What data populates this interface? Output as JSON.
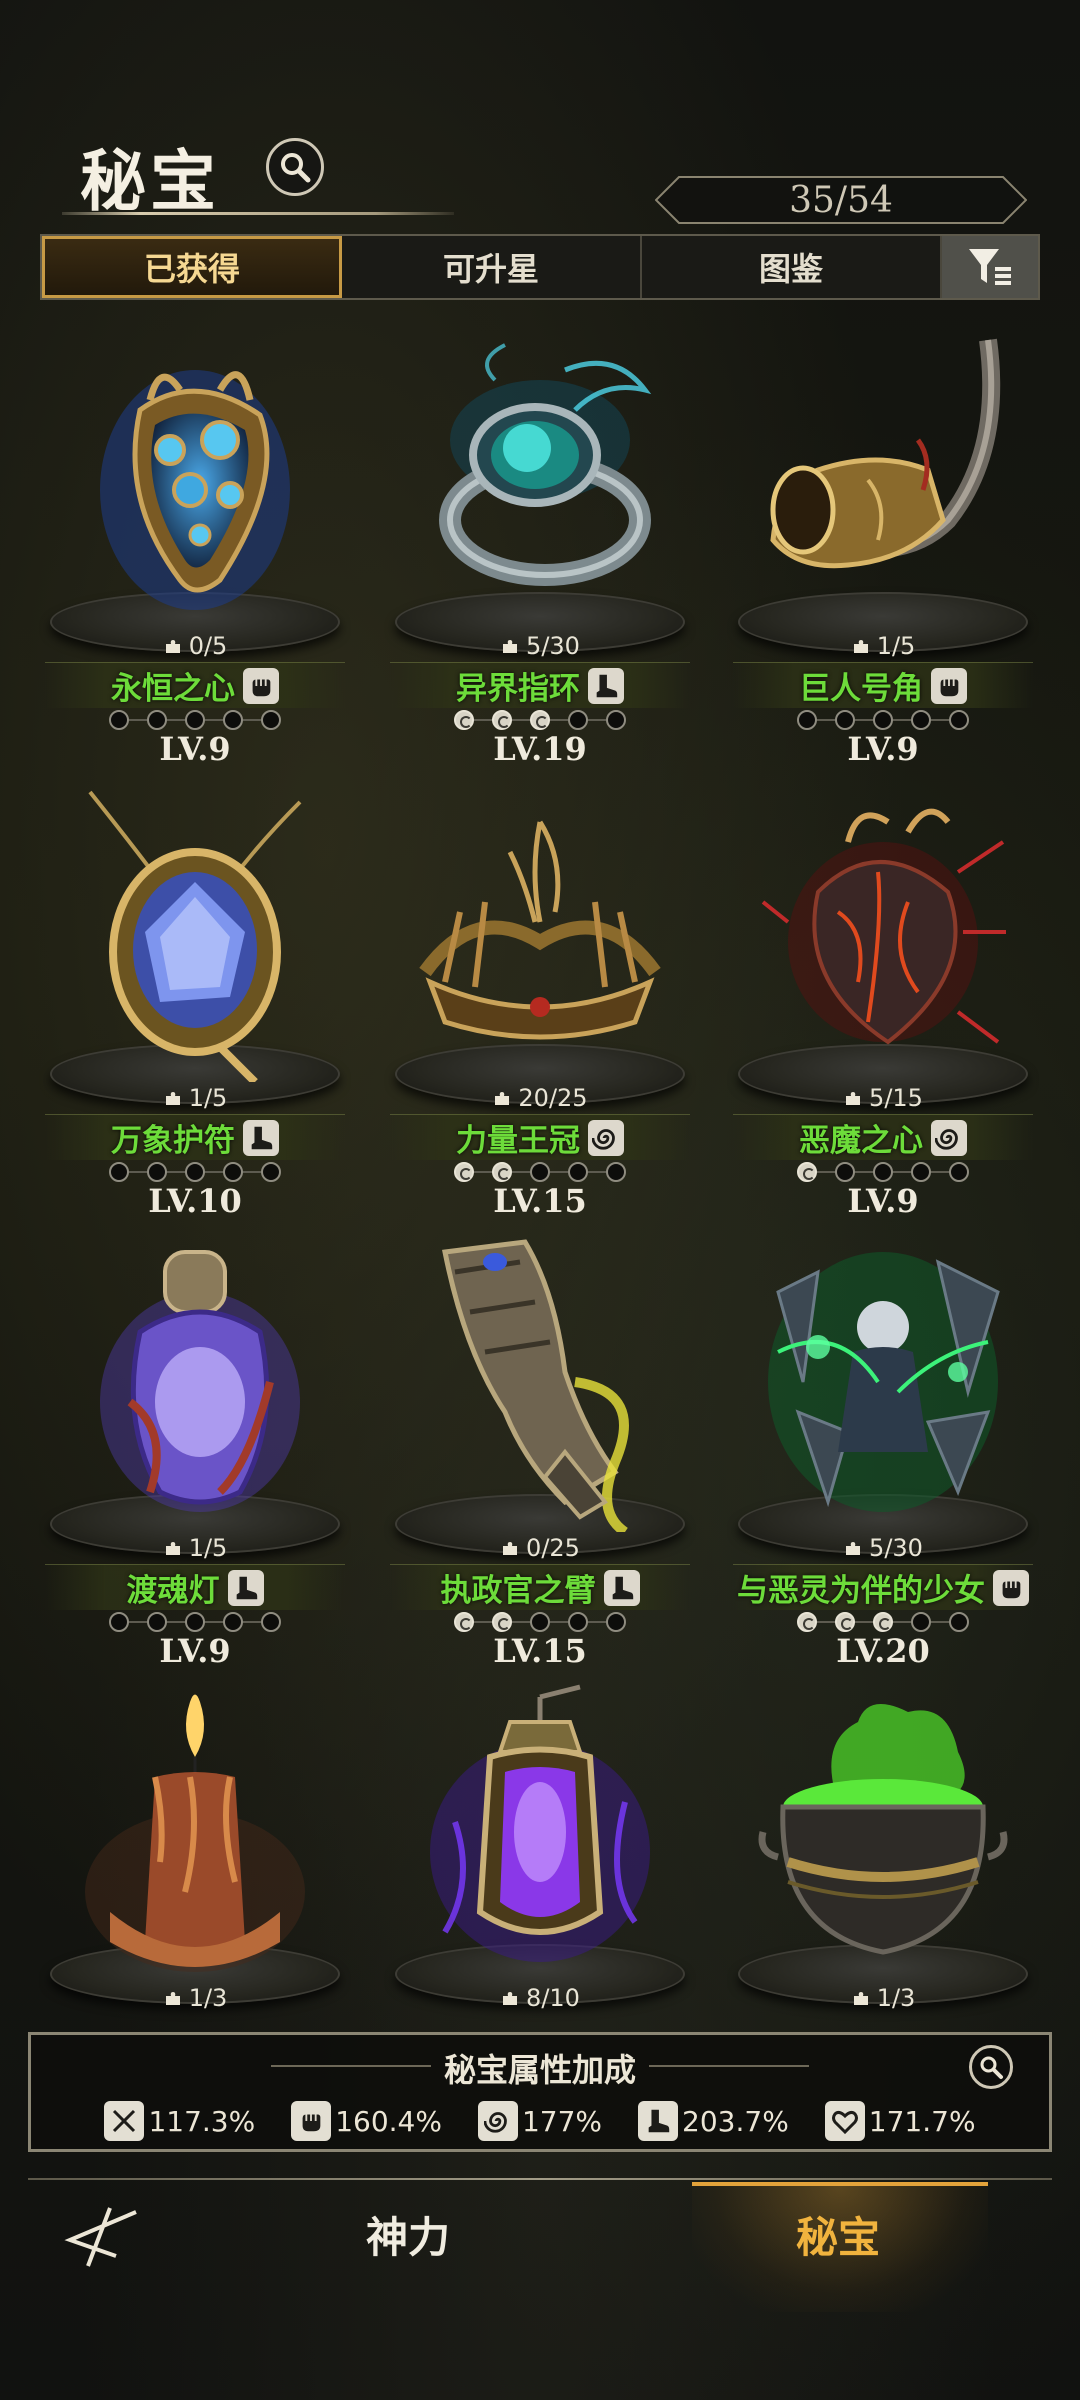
{
  "header": {
    "title": "秘宝",
    "count": "35/54"
  },
  "tabs": [
    {
      "label": "已获得"
    },
    {
      "label": "可升星"
    },
    {
      "label": "图鉴"
    }
  ],
  "items": [
    {
      "name": "永恒之心",
      "fragments": "0/5",
      "level": "LV.9",
      "stars_on": 0,
      "stars_total": 5,
      "type_icon": "fist-icon",
      "art": "heart-mechanical-icon"
    },
    {
      "name": "异界指环",
      "fragments": "5/30",
      "level": "LV.19",
      "stars_on": 3,
      "stars_total": 5,
      "type_icon": "boot-icon",
      "art": "ring-icon"
    },
    {
      "name": "巨人号角",
      "fragments": "1/5",
      "level": "LV.9",
      "stars_on": 0,
      "stars_total": 5,
      "type_icon": "fist-icon",
      "art": "horn-icon"
    },
    {
      "name": "万象护符",
      "fragments": "1/5",
      "level": "LV.10",
      "stars_on": 0,
      "stars_total": 5,
      "type_icon": "boot-icon",
      "art": "amulet-icon"
    },
    {
      "name": "力量王冠",
      "fragments": "20/25",
      "level": "LV.15",
      "stars_on": 2,
      "stars_total": 5,
      "type_icon": "spiral-icon",
      "art": "crown-icon"
    },
    {
      "name": "恶魔之心",
      "fragments": "5/15",
      "level": "LV.9",
      "stars_on": 1,
      "stars_total": 5,
      "type_icon": "spiral-icon",
      "art": "demon-heart-icon"
    },
    {
      "name": "渡魂灯",
      "fragments": "1/5",
      "level": "LV.9",
      "stars_on": 0,
      "stars_total": 5,
      "type_icon": "boot-icon",
      "art": "soul-lamp-icon"
    },
    {
      "name": "执政官之臂",
      "fragments": "0/25",
      "level": "LV.15",
      "stars_on": 2,
      "stars_total": 5,
      "type_icon": "boot-icon",
      "art": "gauntlet-icon"
    },
    {
      "name": "与恶灵为伴的少女",
      "fragments": "5/30",
      "level": "LV.20",
      "stars_on": 3,
      "stars_total": 5,
      "type_icon": "fist-icon",
      "art": "spirit-girl-icon"
    },
    {
      "name": "",
      "fragments": "1/3",
      "level": "",
      "stars_on": 0,
      "stars_total": 0,
      "type_icon": "",
      "art": "candle-icon"
    },
    {
      "name": "",
      "fragments": "8/10",
      "level": "",
      "stars_on": 0,
      "stars_total": 0,
      "type_icon": "",
      "art": "lantern-icon"
    },
    {
      "name": "",
      "fragments": "1/3",
      "level": "",
      "stars_on": 0,
      "stars_total": 0,
      "type_icon": "",
      "art": "cauldron-icon"
    }
  ],
  "stats": {
    "title": "秘宝属性加成",
    "values": [
      {
        "icon": "sword-icon",
        "value": "117.3%"
      },
      {
        "icon": "fist-icon",
        "value": "160.4%"
      },
      {
        "icon": "spiral-icon",
        "value": "177%"
      },
      {
        "icon": "boot-icon",
        "value": "203.7%"
      },
      {
        "icon": "heart-icon",
        "value": "171.7%"
      }
    ]
  },
  "nav": {
    "item1": "神力",
    "item2": "秘宝"
  },
  "colors": {
    "accent": "#e3a33b",
    "item_name": "#6ddc3a",
    "tab_active": "#c79a45"
  }
}
